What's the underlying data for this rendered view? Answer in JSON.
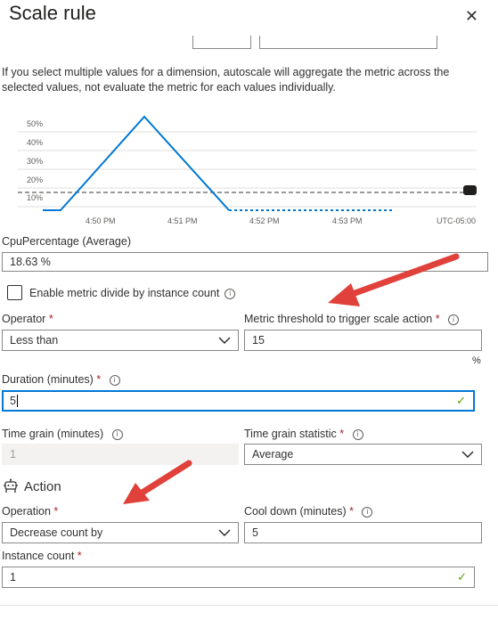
{
  "header": {
    "title": "Scale rule",
    "close_label": "✕"
  },
  "info_text": "If you select multiple values for a dimension, autoscale will aggregate the metric across the selected values, not evaluate the metric for each values individually.",
  "chart": {
    "y_ticks": [
      "50%",
      "40%",
      "30%",
      "20%",
      "10%"
    ],
    "x_ticks": [
      "4:50 PM",
      "4:51 PM",
      "4:52 PM",
      "4:53 PM"
    ],
    "timezone": "UTC-05:00",
    "series_color": "#0078d4",
    "threshold_color": "#605e5c"
  },
  "metric": {
    "label": "CpuPercentage (Average)",
    "value": "18.63 %"
  },
  "divide": {
    "label": "Enable metric divide by instance count"
  },
  "operator": {
    "label": "Operator",
    "required": "*",
    "value": "Less than"
  },
  "threshold": {
    "label": "Metric threshold to trigger scale action",
    "required": "*",
    "value": "15",
    "unit": "%"
  },
  "duration": {
    "label": "Duration (minutes)",
    "required": "*",
    "value": "5"
  },
  "time_grain": {
    "label": "Time grain (minutes)",
    "value": "1"
  },
  "time_grain_statistic": {
    "label": "Time grain statistic",
    "required": "*",
    "value": "Average"
  },
  "action": {
    "heading": "Action"
  },
  "operation": {
    "label": "Operation",
    "required": "*",
    "value": "Decrease count by"
  },
  "cool_down": {
    "label": "Cool down (minutes)",
    "required": "*",
    "value": "5"
  },
  "instance_count": {
    "label": "Instance count",
    "required": "*",
    "value": "1"
  },
  "colors": {
    "accent": "#0078d4",
    "required": "#a4262c",
    "valid_check": "#57a300",
    "annotation_arrow": "#e0413a"
  }
}
